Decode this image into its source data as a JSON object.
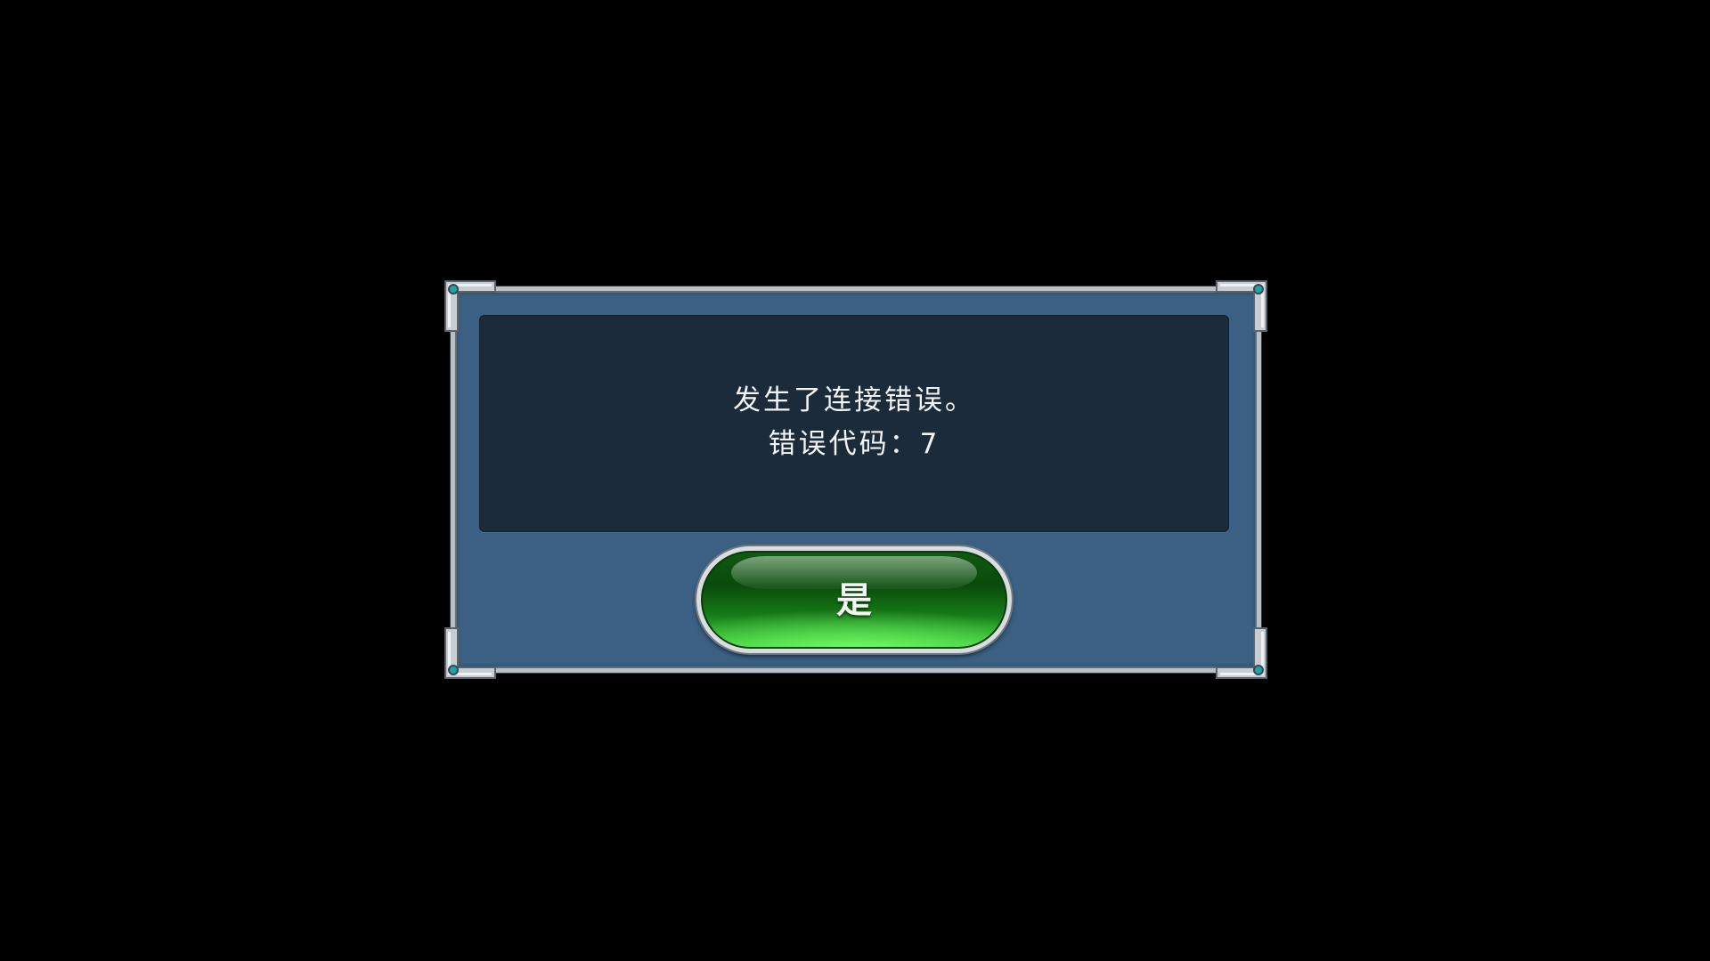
{
  "dialog": {
    "message_line_1": "发生了连接错误。",
    "message_line_2": "错误代码：7",
    "confirm_label": "是"
  },
  "colors": {
    "background": "#000000",
    "dialog_body": "#3b6083",
    "message_panel": "#1c2b3a",
    "frame_metal": "#b9c0c6",
    "button_green": "#1e9a1e",
    "corner_gem": "#1aa6a6"
  },
  "icons": {
    "corner": "metal-corner-bracket-icon"
  }
}
